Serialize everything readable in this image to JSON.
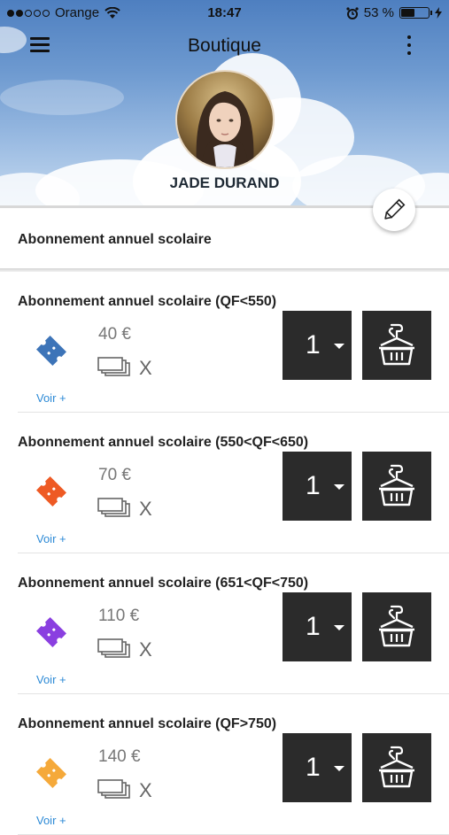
{
  "status_bar": {
    "carrier": "Orange",
    "time": "18:47",
    "battery_text": "53 %",
    "battery_level": 0.53
  },
  "header": {
    "title": "Boutique"
  },
  "profile": {
    "name": "JADE DURAND"
  },
  "section": {
    "title": "Abonnement annuel scolaire"
  },
  "products": [
    {
      "title": "Abonnement annuel scolaire (QF<550)",
      "price": "40 €",
      "qty_x": "X",
      "more": "Voir +",
      "quantity": "1",
      "color": "#3d74b8"
    },
    {
      "title": "Abonnement annuel scolaire (550<QF<650)",
      "price": "70 €",
      "qty_x": "X",
      "more": "Voir +",
      "quantity": "1",
      "color": "#ee5a24"
    },
    {
      "title": "Abonnement annuel scolaire (651<QF<750)",
      "price": "110 €",
      "qty_x": "X",
      "more": "Voir +",
      "quantity": "1",
      "color": "#8a3fe0"
    },
    {
      "title": "Abonnement annuel scolaire (QF>750)",
      "price": "140 €",
      "qty_x": "X",
      "more": "Voir +",
      "quantity": "1",
      "color": "#f5a93a"
    }
  ],
  "icons": {
    "menu": "menu-icon",
    "more": "more-vertical-icon",
    "edit": "pencil-icon",
    "ticket": "ticket-icon",
    "tickets": "tickets-stack-icon",
    "cart": "add-to-basket-icon",
    "wifi": "wifi-icon",
    "alarm": "alarm-icon",
    "battery": "battery-icon",
    "charging": "charging-icon"
  }
}
